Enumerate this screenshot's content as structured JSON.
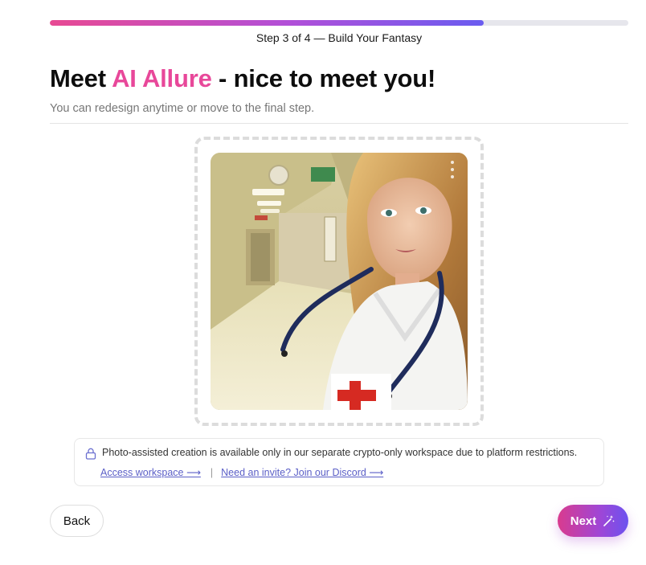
{
  "progress": {
    "step_text": "Step 3 of 4 — Build Your Fantasy",
    "fraction": 0.75
  },
  "header": {
    "title_prefix": "Meet ",
    "companion_name": "AI Allure",
    "title_suffix": " - nice to meet you!",
    "subtitle": "You can redesign anytime or move to the final step."
  },
  "preview": {
    "image": "generated-companion-portrait",
    "menu_icon": "more-vertical-icon"
  },
  "notice": {
    "icon": "lock-icon",
    "text": "Photo-assisted creation is available only in our separate crypto-only workspace due to platform restrictions.",
    "link_workspace": "Access workspace ⟶",
    "separator": "|",
    "link_discord": "Need an invite? Join our Discord ⟶"
  },
  "footer": {
    "back_label": "Back",
    "next_label": "Next",
    "next_icon": "magic-wand-icon"
  },
  "colors": {
    "accent_pink": "#e8489a",
    "accent_violet": "#6a5cf0",
    "link": "#5b5fc7"
  }
}
